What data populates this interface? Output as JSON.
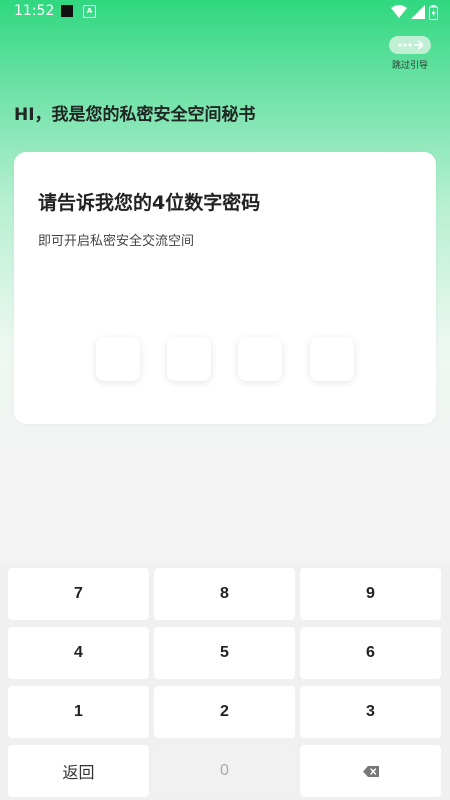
{
  "status_bar": {
    "time": "11:52",
    "indicator_icon": "notification-square-icon",
    "app_icon": "a-badge-icon",
    "right_icons": [
      "wifi-icon",
      "signal-icon",
      "battery-icon"
    ]
  },
  "header": {
    "skip_label": "跳过引导",
    "greeting": "HI，我是您的私密安全空间秘书"
  },
  "card": {
    "title": "请告诉我您的4位数字密码",
    "subtitle": "即可开启私密安全交流空间",
    "pin_length": 4
  },
  "keypad": {
    "rows": [
      [
        "7",
        "8",
        "9"
      ],
      [
        "4",
        "5",
        "6"
      ],
      [
        "1",
        "2",
        "3"
      ]
    ],
    "back_label": "返回",
    "zero_label": "0",
    "delete_icon": "backspace-icon"
  },
  "colors": {
    "accent_green": "#2fd87f",
    "background_gray": "#f3f3f3"
  }
}
